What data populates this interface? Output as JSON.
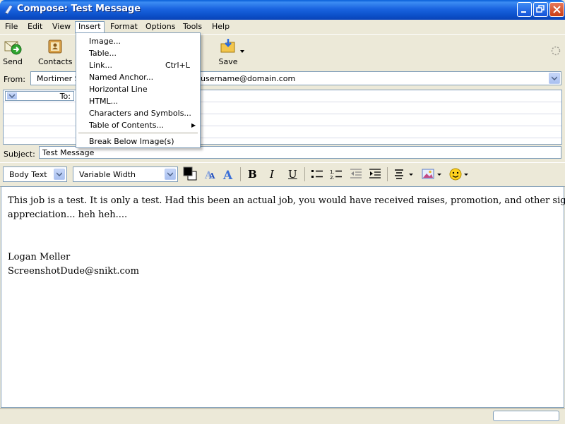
{
  "window": {
    "title": "Compose: Test Message"
  },
  "menubar": [
    "File",
    "Edit",
    "View",
    "Insert",
    "Format",
    "Options",
    "Tools",
    "Help"
  ],
  "toolbar": {
    "send": "Send",
    "contacts": "Contacts",
    "save": "Save"
  },
  "header": {
    "from_label": "From:",
    "from_name": "Mortimer S",
    "from_email": "username@domain.com",
    "to_label": "To:",
    "subject_label": "Subject:",
    "subject_value": "Test Message"
  },
  "format": {
    "paragraph": "Body Text",
    "font": "Variable Width",
    "bold": "B",
    "italic": "I",
    "underline": "U"
  },
  "insert_menu": {
    "items": [
      "Image...",
      "Table...",
      "Link...",
      "Named Anchor...",
      "Horizontal Line",
      "HTML...",
      "Characters and Symbols...",
      "Table of Contents...",
      "Break Below Image(s)"
    ],
    "link_shortcut": "Ctrl+L"
  },
  "body": {
    "line1": "This job is a test.  It is only a test.  Had this been an actual job, you would have received raises, promotion, and other signs of",
    "line2": "appreciation... heh heh....",
    "sig_name": "Logan Meller",
    "sig_email": "ScreenshotDude@snikt.com"
  },
  "colors": {
    "titlebar": "#0a5fd8",
    "menu_bg": "#ece9d8",
    "border": "#7f9db9"
  }
}
